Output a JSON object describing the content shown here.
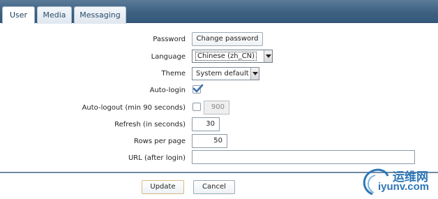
{
  "tabs": [
    {
      "label": "User",
      "active": true
    },
    {
      "label": "Media",
      "active": false
    },
    {
      "label": "Messaging",
      "active": false
    }
  ],
  "form": {
    "password_label": "Password",
    "change_password_button": "Change password",
    "language_label": "Language",
    "language_value": "Chinese (zh_CN)",
    "theme_label": "Theme",
    "theme_value": "System default",
    "autologin_label": "Auto-login",
    "autologin_checked": true,
    "autologout_label": "Auto-logout (min 90 seconds)",
    "autologout_checked": false,
    "autologout_value": "900",
    "refresh_label": "Refresh (in seconds)",
    "refresh_value": "30",
    "rows_label": "Rows per page",
    "rows_value": "50",
    "url_label": "URL (after login)",
    "url_value": ""
  },
  "buttons": {
    "update": "Update",
    "cancel": "Cancel"
  },
  "watermark": {
    "line1": "运维网",
    "line2": "iyunv.com"
  },
  "colors": {
    "header_bar": "#3c5f80",
    "checkmark": "#3a6fb0",
    "logo": "#2e77b8"
  }
}
